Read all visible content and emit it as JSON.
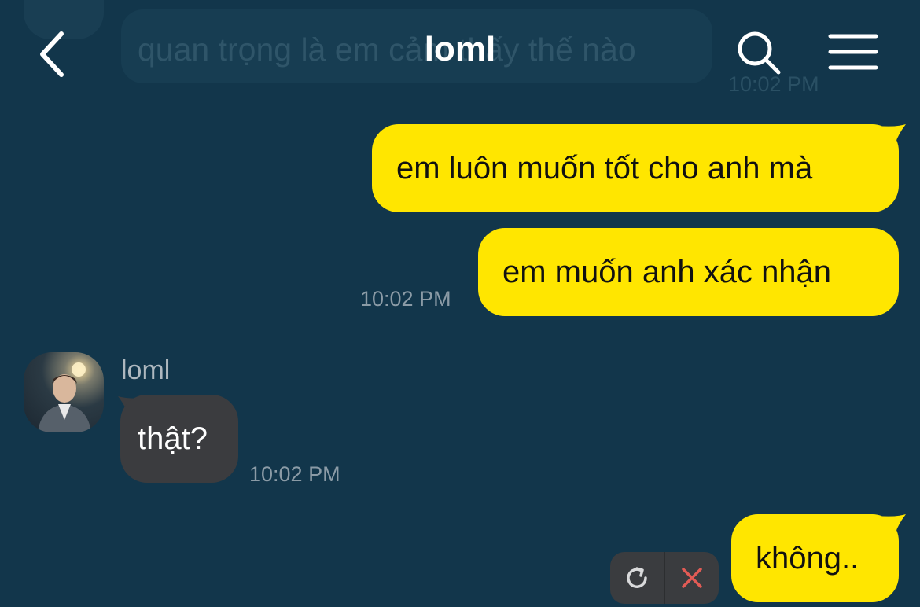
{
  "header": {
    "title": "loml",
    "back_icon": "chevron-left-icon",
    "search_icon": "search-icon",
    "menu_icon": "hamburger-menu-icon"
  },
  "previous_message": {
    "text": "quan trọng là em cảm thấy thế nào",
    "time": "10:02 PM"
  },
  "messages": [
    {
      "direction": "outgoing",
      "text": "em luôn muốn tốt cho anh mà"
    },
    {
      "direction": "outgoing",
      "text": "em muốn anh xác nhận",
      "time": "10:02 PM"
    },
    {
      "direction": "incoming",
      "sender": "loml",
      "text": "thật?",
      "time": "10:02 PM"
    },
    {
      "direction": "outgoing",
      "text": "không..",
      "status": "failed"
    }
  ],
  "failed_actions": {
    "retry_icon": "retry-icon",
    "delete_icon": "close-icon"
  },
  "colors": {
    "background": "#12364b",
    "outgoing_bubble": "#ffe600",
    "incoming_bubble": "#3b3c3f",
    "delete_accent": "#e25b55"
  }
}
